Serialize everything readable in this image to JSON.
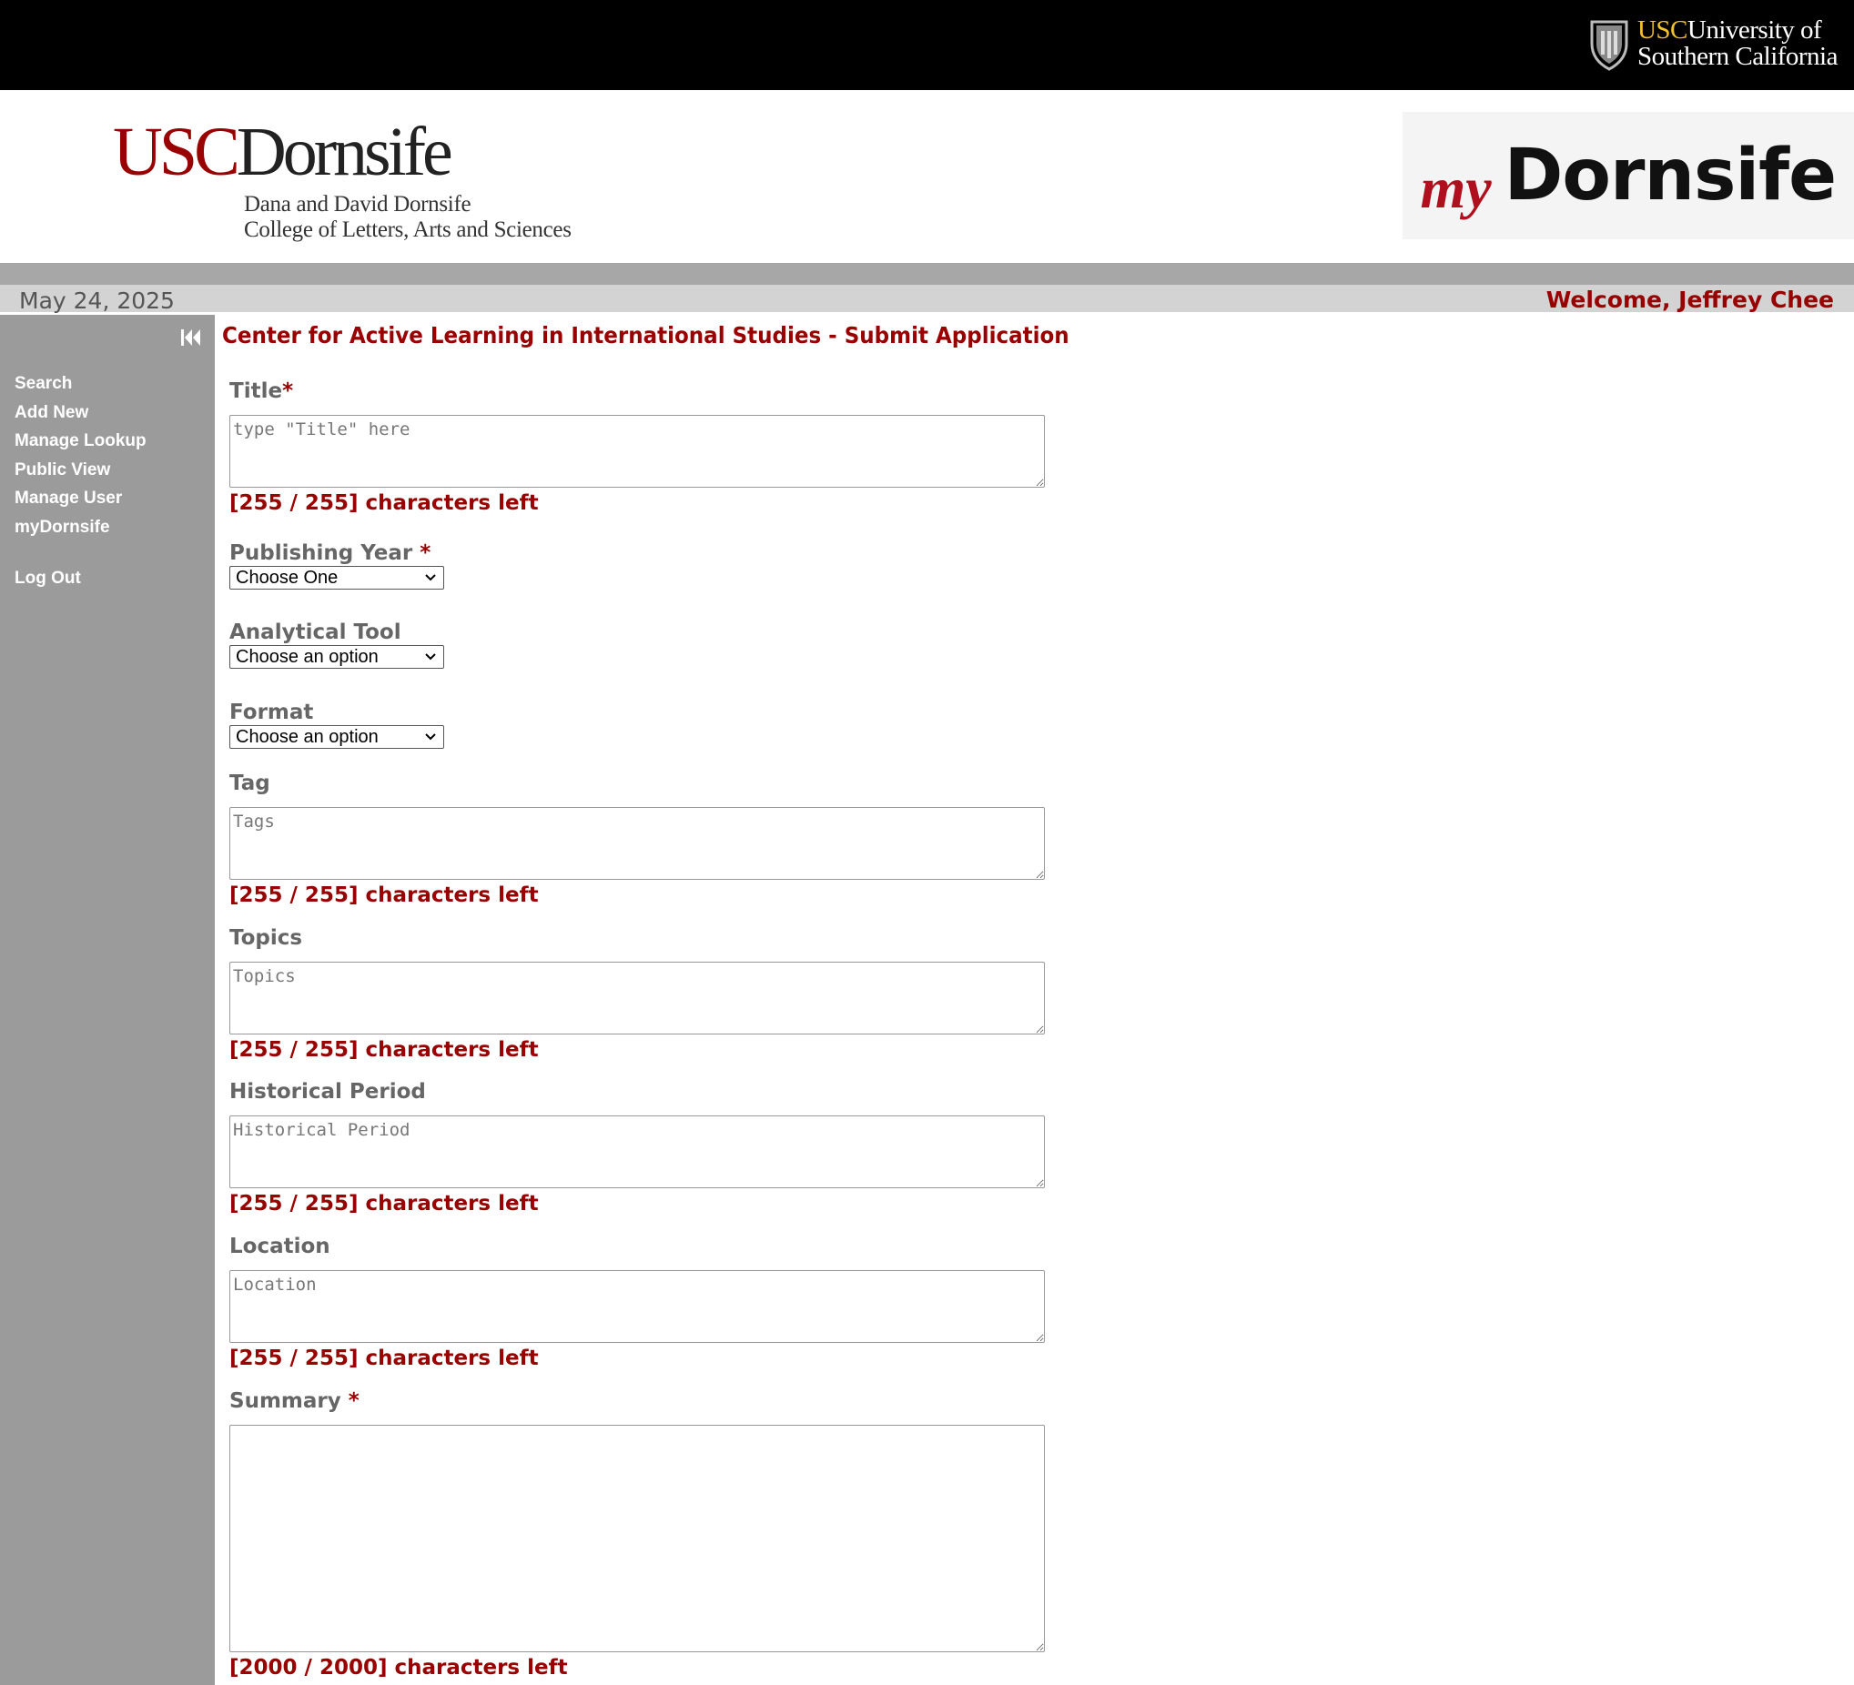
{
  "topbar": {
    "univ_usc": "USC",
    "univ_line1": "University of",
    "univ_line2": "Southern California"
  },
  "header": {
    "logo_usc": "USC",
    "logo_name": "Dornsife",
    "logo_sub1": "Dana and David Dornsife",
    "logo_sub2": "College of Letters, Arts and Sciences",
    "my_logo_my": "my",
    "my_logo_name": "Dornsife"
  },
  "status": {
    "date": "May 24, 2025",
    "welcome": "Welcome, Jeffrey Chee"
  },
  "sidebar": {
    "items": [
      {
        "label": "Search"
      },
      {
        "label": "Add New"
      },
      {
        "label": "Manage Lookup"
      },
      {
        "label": "Public View"
      },
      {
        "label": "Manage User"
      },
      {
        "label": "myDornsife"
      }
    ],
    "logout": "Log Out"
  },
  "main": {
    "title": "Center for Active Learning in International Studies - Submit Application",
    "fields": {
      "title": {
        "label": "Title",
        "required": "*",
        "placeholder": "type \"Title\" here",
        "counter": "[255 / 255] characters left"
      },
      "year": {
        "label": "Publishing Year",
        "required": "*",
        "value": "Choose One"
      },
      "tool": {
        "label": "Analytical Tool",
        "value": "Choose an option"
      },
      "format": {
        "label": "Format",
        "value": "Choose an option"
      },
      "tag": {
        "label": "Tag",
        "placeholder": "Tags",
        "counter": "[255 / 255] characters left"
      },
      "topics": {
        "label": "Topics",
        "placeholder": "Topics",
        "counter": "[255 / 255] characters left"
      },
      "period": {
        "label": "Historical Period",
        "placeholder": "Historical Period",
        "counter": "[255 / 255] characters left"
      },
      "location": {
        "label": "Location",
        "placeholder": "Location",
        "counter": "[255 / 255] characters left"
      },
      "summary": {
        "label": "Summary",
        "required": "*",
        "placeholder": "",
        "counter": "[2000 / 2000] characters left"
      }
    }
  },
  "colors": {
    "brand_red": "#990000",
    "sidebar_gray": "#9b9b9b",
    "label_gray": "#666666"
  }
}
